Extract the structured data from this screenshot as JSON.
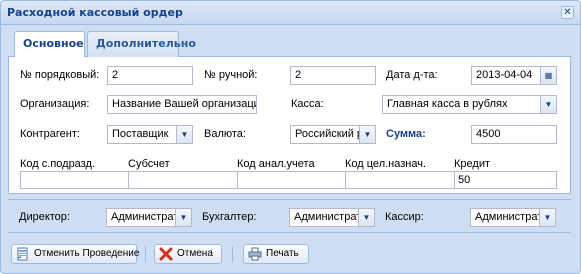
{
  "window": {
    "title": "Расходной кассовый ордер"
  },
  "tabs": [
    {
      "label": "Основное"
    },
    {
      "label": "Дополнительно"
    }
  ],
  "form": {
    "order_no_label": "№ порядковый:",
    "order_no_value": "2",
    "manual_no_label": "№ ручной:",
    "manual_no_value": "2",
    "date_label": "Дата д-та:",
    "date_value": "2013-04-04",
    "org_label": "Организация:",
    "org_value": "Название Вашей организации",
    "cash_label": "Касса:",
    "cash_value": "Главная касса в рублях",
    "contractor_label": "Контрагент:",
    "contractor_value": "Поставщик",
    "currency_label": "Валюта:",
    "currency_value": "Российский р",
    "sum_label": "Сумма:",
    "sum_value": "4500"
  },
  "accounting": {
    "columns": [
      "Код с.подразд.",
      "Субсчет",
      "Код анал.учета",
      "Код цел.назнач.",
      "Кредит"
    ],
    "values": [
      "",
      "",
      "",
      "",
      "50"
    ]
  },
  "signatures": {
    "director_label": "Директор:",
    "director_value": "Администрат",
    "accountant_label": "Бухгалтер:",
    "accountant_value": "Администрат",
    "cashier_label": "Кассир:",
    "cashier_value": "Администрат"
  },
  "toolbar": {
    "cancel_posting_label": "Отменить Проведение",
    "cancel_label": "Отмена",
    "print_label": "Печать"
  }
}
